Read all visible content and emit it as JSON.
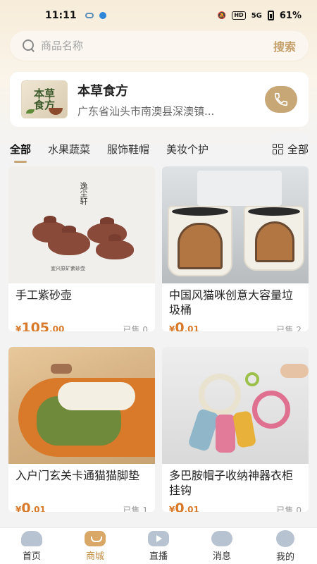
{
  "status_bar": {
    "time": "11:11",
    "battery": "61%",
    "network": "5G"
  },
  "search": {
    "placeholder": "商品名称",
    "button_label": "搜索"
  },
  "shop": {
    "logo_text": "本草食方",
    "name": "本草食方",
    "address": "广东省汕头市南澳县深澳镇..."
  },
  "tabs": [
    {
      "label": "全部",
      "active": true
    },
    {
      "label": "水果蔬菜",
      "active": false
    },
    {
      "label": "服饰鞋帽",
      "active": false
    },
    {
      "label": "美妆个护",
      "active": false
    }
  ],
  "all_button_label": "全部",
  "products": [
    {
      "name": "手工紫砂壶",
      "price_symbol": "¥",
      "price_int": "105",
      "price_dec": ".00",
      "sold": "已售 0",
      "image_text": "逸尘轩",
      "image_caption": "宜兴原矿紫砂壶"
    },
    {
      "name": "中国风猫咪创意大容量垃圾桶",
      "price_symbol": "¥",
      "price_int": "0",
      "price_dec": ".01",
      "sold": "已售 2"
    },
    {
      "name": "入户门玄关卡通猫猫脚垫",
      "price_symbol": "¥",
      "price_int": "0",
      "price_dec": ".01",
      "sold": "已售 1"
    },
    {
      "name": "多巴胺帽子收纳神器衣柜挂钩",
      "price_symbol": "¥",
      "price_int": "0",
      "price_dec": ".01",
      "sold": "已售 0"
    }
  ],
  "nav": [
    {
      "label": "首页",
      "icon": "home-icon",
      "active": false
    },
    {
      "label": "商城",
      "icon": "shop-icon",
      "active": true
    },
    {
      "label": "直播",
      "icon": "live-icon",
      "active": false
    },
    {
      "label": "消息",
      "icon": "message-icon",
      "active": false
    },
    {
      "label": "我的",
      "icon": "profile-icon",
      "active": false
    }
  ],
  "colors": {
    "accent": "#c8a777",
    "price": "#d9792a",
    "active_nav": "#c08a3e"
  }
}
